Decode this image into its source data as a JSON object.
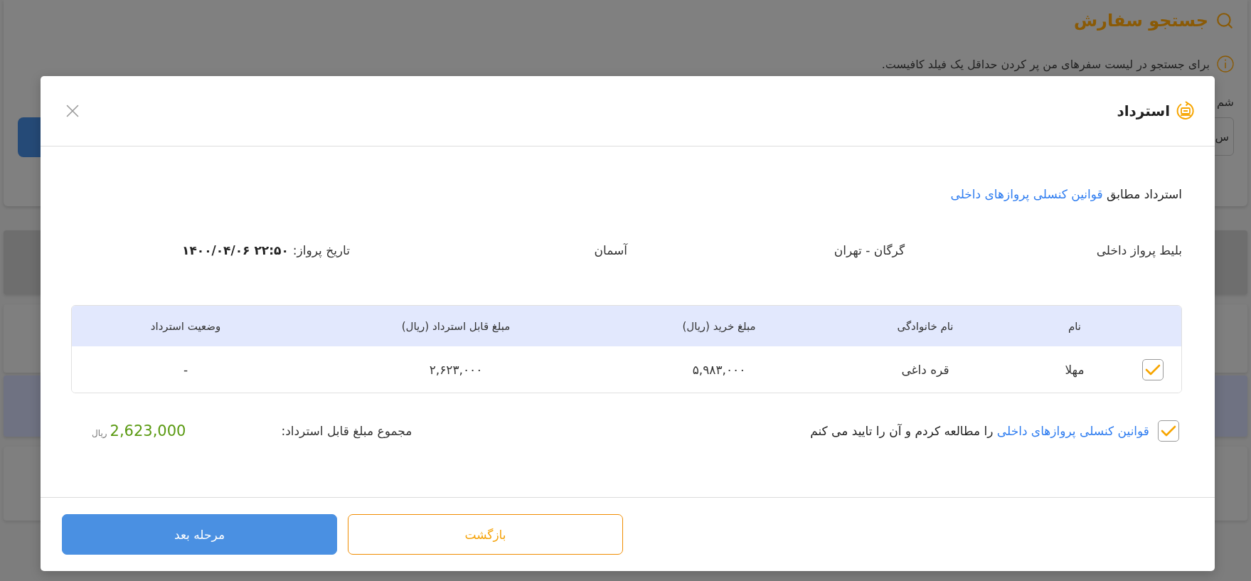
{
  "background": {
    "title": "جستجو سفارش",
    "info": "برای جستجو در لیست سفرهای من پر کردن حداقل یک فیلد کافیست.",
    "field_label": "شم",
    "field_value": "س"
  },
  "modal": {
    "title": "استرداد",
    "intro": {
      "text": "استرداد مطابق",
      "link": "قوانین کنسلی پروازهای داخلی"
    },
    "flight": {
      "type": "بلیط پرواز داخلی",
      "route": "گرگان - تهران",
      "airline": "آسمان",
      "date_label": "تاریخ پرواز:",
      "time": "۲۲:۵۰",
      "date": "۱۴۰۰/۰۴/۰۶"
    },
    "table": {
      "columns": [
        "نام",
        "نام خانوادگی",
        "مبلغ خرید (ریال)",
        "مبلغ قابل استرداد (ریال)",
        "وضعیت استرداد"
      ],
      "rows": [
        {
          "checked": true,
          "cells": [
            "مهلا",
            "قره داغی",
            "۵,۹۸۳,۰۰۰",
            "۲,۶۲۳,۰۰۰",
            "-"
          ]
        }
      ]
    },
    "consent": {
      "checked": true,
      "link": "قوانین کنسلی پروازهای داخلی",
      "text": "را مطالعه کردم و آن را تایید می کنم"
    },
    "total": {
      "label": "مجموع مبلغ قابل استرداد:",
      "amount": "2,623,000",
      "currency": "ریال"
    },
    "buttons": [
      {
        "kind": "secondary",
        "label": "بازگشت"
      },
      {
        "kind": "primary",
        "label": "مرحله بعد"
      }
    ]
  }
}
